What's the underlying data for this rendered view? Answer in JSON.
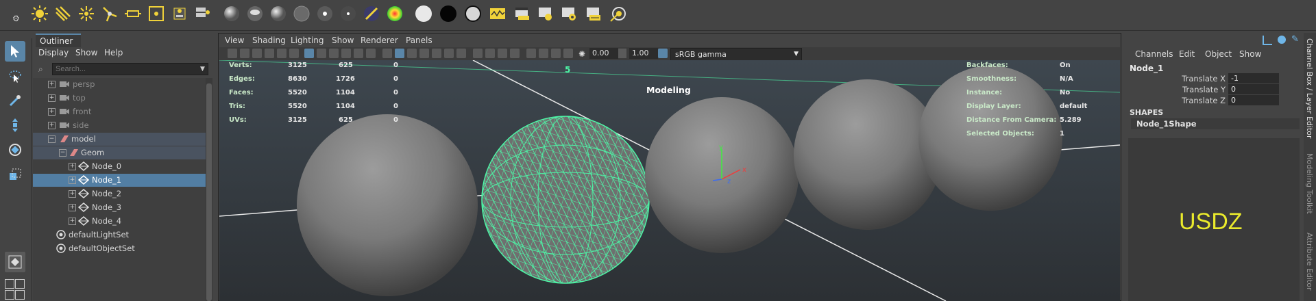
{
  "outliner": {
    "tab": "Outliner",
    "menu": [
      "Display",
      "Show",
      "Help"
    ],
    "search_placeholder": "Search...",
    "rows": [
      {
        "label": "persp",
        "dim": true
      },
      {
        "label": "top",
        "dim": true
      },
      {
        "label": "front",
        "dim": true
      },
      {
        "label": "side",
        "dim": true
      },
      {
        "label": "model",
        "dim": false
      },
      {
        "label": "Geom",
        "dim": false
      },
      {
        "label": "Node_0",
        "dim": false
      },
      {
        "label": "Node_1",
        "dim": false,
        "selected": true
      },
      {
        "label": "Node_2",
        "dim": false
      },
      {
        "label": "Node_3",
        "dim": false
      },
      {
        "label": "Node_4",
        "dim": false
      },
      {
        "label": "defaultLightSet",
        "dim": false
      },
      {
        "label": "defaultObjectSet",
        "dim": false
      }
    ]
  },
  "viewport": {
    "menu": [
      "View",
      "Shading",
      "Lighting",
      "Show",
      "Renderer",
      "Panels"
    ],
    "exposure": "0.00",
    "gamma": "1.00",
    "colorspace": "sRGB gamma",
    "mode_label": "Modeling",
    "frame_marker": "5",
    "hud_stats": [
      {
        "label": "Verts:",
        "a": "3125",
        "b": "625",
        "c": "0"
      },
      {
        "label": "Edges:",
        "a": "8630",
        "b": "1726",
        "c": "0"
      },
      {
        "label": "Faces:",
        "a": "5520",
        "b": "1104",
        "c": "0"
      },
      {
        "label": "Tris:",
        "a": "5520",
        "b": "1104",
        "c": "0"
      },
      {
        "label": "UVs:",
        "a": "3125",
        "b": "625",
        "c": "0"
      }
    ],
    "hud_info": [
      {
        "label": "Backfaces:",
        "value": "On"
      },
      {
        "label": "Smoothness:",
        "value": "N/A"
      },
      {
        "label": "Instance:",
        "value": "No"
      },
      {
        "label": "Display Layer:",
        "value": "default"
      },
      {
        "label": "Distance From Camera:",
        "value": "5.289"
      },
      {
        "label": "Selected Objects:",
        "value": "1"
      }
    ],
    "axis": {
      "x": "x",
      "y": "y",
      "z": "z"
    }
  },
  "channel_box": {
    "menu": [
      "Channels",
      "Edit",
      "Object",
      "Show"
    ],
    "node": "Node_1",
    "attrs": [
      {
        "label": "Translate X",
        "value": "-1"
      },
      {
        "label": "Translate Y",
        "value": "0"
      },
      {
        "label": "Translate Z",
        "value": "0"
      }
    ],
    "shapes_header": "SHAPES",
    "shape_node": "Node_1Shape",
    "usdz_label": "USDZ"
  },
  "side_tabs": [
    "Channel Box / Layer Editor",
    "Modeling Toolkit",
    "Attribute Editor"
  ],
  "colors": {
    "accent": "#527ea3",
    "wire": "#4df5a6",
    "usdz": "#eaea2c"
  }
}
